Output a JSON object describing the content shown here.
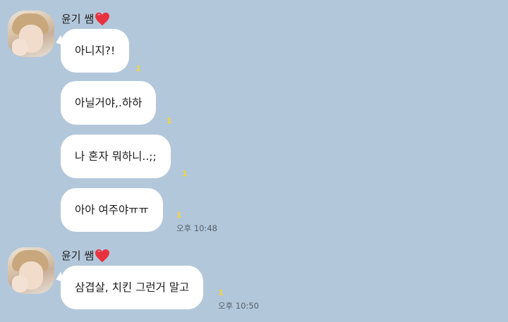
{
  "groups": [
    {
      "sender": "윤기 쌤",
      "messages": [
        {
          "text": "아니지?!",
          "unread": "1",
          "time": ""
        },
        {
          "text": "아닐거야,.하하",
          "unread": "1",
          "time": ""
        },
        {
          "text": "나 혼자 뭐하니..;;",
          "unread": "1",
          "time": ""
        },
        {
          "text": "아아 여주야ㅠㅠ",
          "unread": "1",
          "time": "오후 10:48"
        }
      ]
    },
    {
      "sender": "윤기 쌤",
      "messages": [
        {
          "text": "삼겹살, 치킨 그런거 말고",
          "unread": "1",
          "time": "오후 10:50"
        }
      ]
    }
  ],
  "colors": {
    "background": "#b2c7da",
    "bubble": "#ffffff",
    "unread": "#f2d43a",
    "heart": "#e8323e"
  },
  "icons": {
    "sender_decoration": "heart-icon"
  }
}
